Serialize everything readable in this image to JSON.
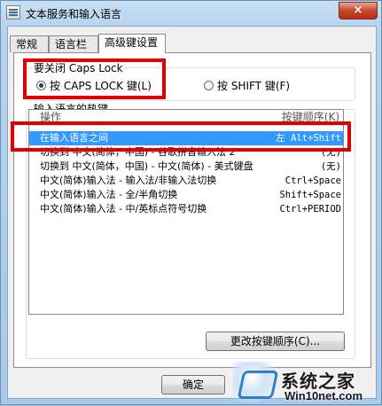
{
  "window": {
    "title": "文本服务和输入语言",
    "close_label": "×"
  },
  "tabs": [
    {
      "label": "常规"
    },
    {
      "label": "语言栏"
    },
    {
      "label": "高级键设置"
    }
  ],
  "caps_group": {
    "label": "要关闭 Caps Lock",
    "option_caps": "按 CAPS LOCK 键(L)",
    "option_shift": "按 SHIFT 键(F)"
  },
  "hotkey_group": {
    "label": "输入语言的热键",
    "header_action": "操作",
    "header_keys": "按键顺序(K)",
    "rows": [
      {
        "action": "在输入语言之间",
        "keys": "左 Alt+Shift"
      },
      {
        "action": "切换到 中文(简体，中国) - 谷歌拼音输入法 2",
        "keys": "(无)"
      },
      {
        "action": "切换到 中文(简体，中国) - 中文(简体) - 美式键盘",
        "keys": "(无)"
      },
      {
        "action": "中文(简体)输入法 - 输入法/非输入法切换",
        "keys": "Ctrl+Space"
      },
      {
        "action": "中文(简体)输入法 - 全/半角切换",
        "keys": "Shift+Space"
      },
      {
        "action": "中文(简体)输入法 - 中/英标点符号切换",
        "keys": "Ctrl+PERIOD"
      }
    ],
    "change_button": "更改按键顺序(C)..."
  },
  "footer": {
    "ok_button": "确定"
  },
  "watermark": {
    "cn": "系统之家",
    "en": "Win10net.com"
  },
  "colors": {
    "highlight_box": "#e00000",
    "selection": "#3399ff"
  }
}
